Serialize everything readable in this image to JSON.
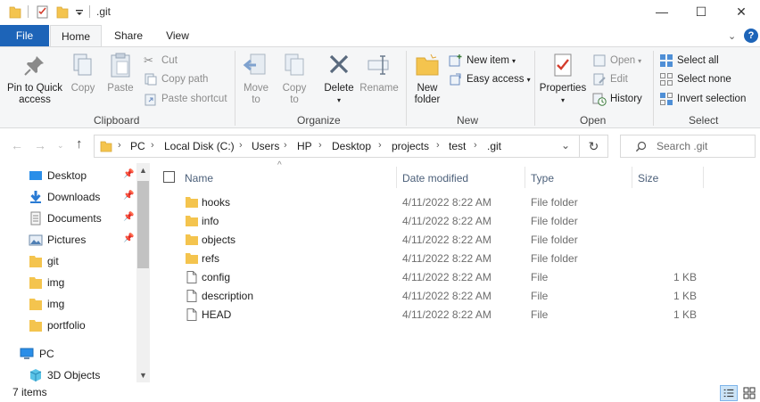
{
  "window": {
    "title": ".git",
    "minimize": "—",
    "maximize": "☐",
    "close": "✕"
  },
  "ribbon_tabs": {
    "file": "File",
    "home": "Home",
    "share": "Share",
    "view": "View"
  },
  "clipboard": {
    "pin_label": "Pin to Quick access",
    "pin_line1": "Pin to Quick",
    "pin_line2": "access",
    "copy": "Copy",
    "paste": "Paste",
    "cut": "Cut",
    "copy_path": "Copy path",
    "paste_shortcut": "Paste shortcut",
    "group_label": "Clipboard"
  },
  "organize": {
    "move_to_line1": "Move",
    "move_to_line2": "to",
    "copy_to_line1": "Copy",
    "copy_to_line2": "to",
    "delete": "Delete",
    "rename": "Rename",
    "group_label": "Organize"
  },
  "new": {
    "new_folder_line1": "New",
    "new_folder_line2": "folder",
    "new_item": "New item",
    "easy_access": "Easy access",
    "group_label": "New"
  },
  "open": {
    "properties": "Properties",
    "open": "Open",
    "edit": "Edit",
    "history": "History",
    "group_label": "Open"
  },
  "select": {
    "select_all": "Select all",
    "select_none": "Select none",
    "invert_selection": "Invert selection",
    "group_label": "Select"
  },
  "address": {
    "crumbs": [
      "PC",
      "Local Disk (C:)",
      "Users",
      "HP",
      "Desktop",
      "projects",
      "test",
      ".git"
    ],
    "search_placeholder": "Search .git"
  },
  "nav_pane": {
    "items": [
      {
        "label": "Desktop",
        "icon": "desktop-icon",
        "pinned": true
      },
      {
        "label": "Downloads",
        "icon": "downloads-icon",
        "pinned": true
      },
      {
        "label": "Documents",
        "icon": "documents-icon",
        "pinned": true
      },
      {
        "label": "Pictures",
        "icon": "pictures-icon",
        "pinned": true
      },
      {
        "label": "git",
        "icon": "folder-icon",
        "pinned": false
      },
      {
        "label": "img",
        "icon": "folder-icon",
        "pinned": false
      },
      {
        "label": "img",
        "icon": "folder-icon",
        "pinned": false
      },
      {
        "label": "portfolio",
        "icon": "folder-icon",
        "pinned": false
      },
      {
        "label": "PC",
        "icon": "pc-icon",
        "pinned": false
      },
      {
        "label": "3D Objects",
        "icon": "3d-objects-icon",
        "pinned": false
      }
    ]
  },
  "file_list": {
    "columns": {
      "name": "Name",
      "date_modified": "Date modified",
      "type": "Type",
      "size": "Size"
    },
    "rows": [
      {
        "name": "hooks",
        "date": "4/11/2022 8:22 AM",
        "type": "File folder",
        "size": "",
        "kind": "folder"
      },
      {
        "name": "info",
        "date": "4/11/2022 8:22 AM",
        "type": "File folder",
        "size": "",
        "kind": "folder"
      },
      {
        "name": "objects",
        "date": "4/11/2022 8:22 AM",
        "type": "File folder",
        "size": "",
        "kind": "folder"
      },
      {
        "name": "refs",
        "date": "4/11/2022 8:22 AM",
        "type": "File folder",
        "size": "",
        "kind": "folder"
      },
      {
        "name": "config",
        "date": "4/11/2022 8:22 AM",
        "type": "File",
        "size": "1 KB",
        "kind": "file"
      },
      {
        "name": "description",
        "date": "4/11/2022 8:22 AM",
        "type": "File",
        "size": "1 KB",
        "kind": "file"
      },
      {
        "name": "HEAD",
        "date": "4/11/2022 8:22 AM",
        "type": "File",
        "size": "1 KB",
        "kind": "file"
      }
    ]
  },
  "status": {
    "item_count": "7 items"
  },
  "colors": {
    "accent": "#1d64b8",
    "folder": "#f4c44e",
    "ribbon_bg": "#f5f6f7"
  }
}
